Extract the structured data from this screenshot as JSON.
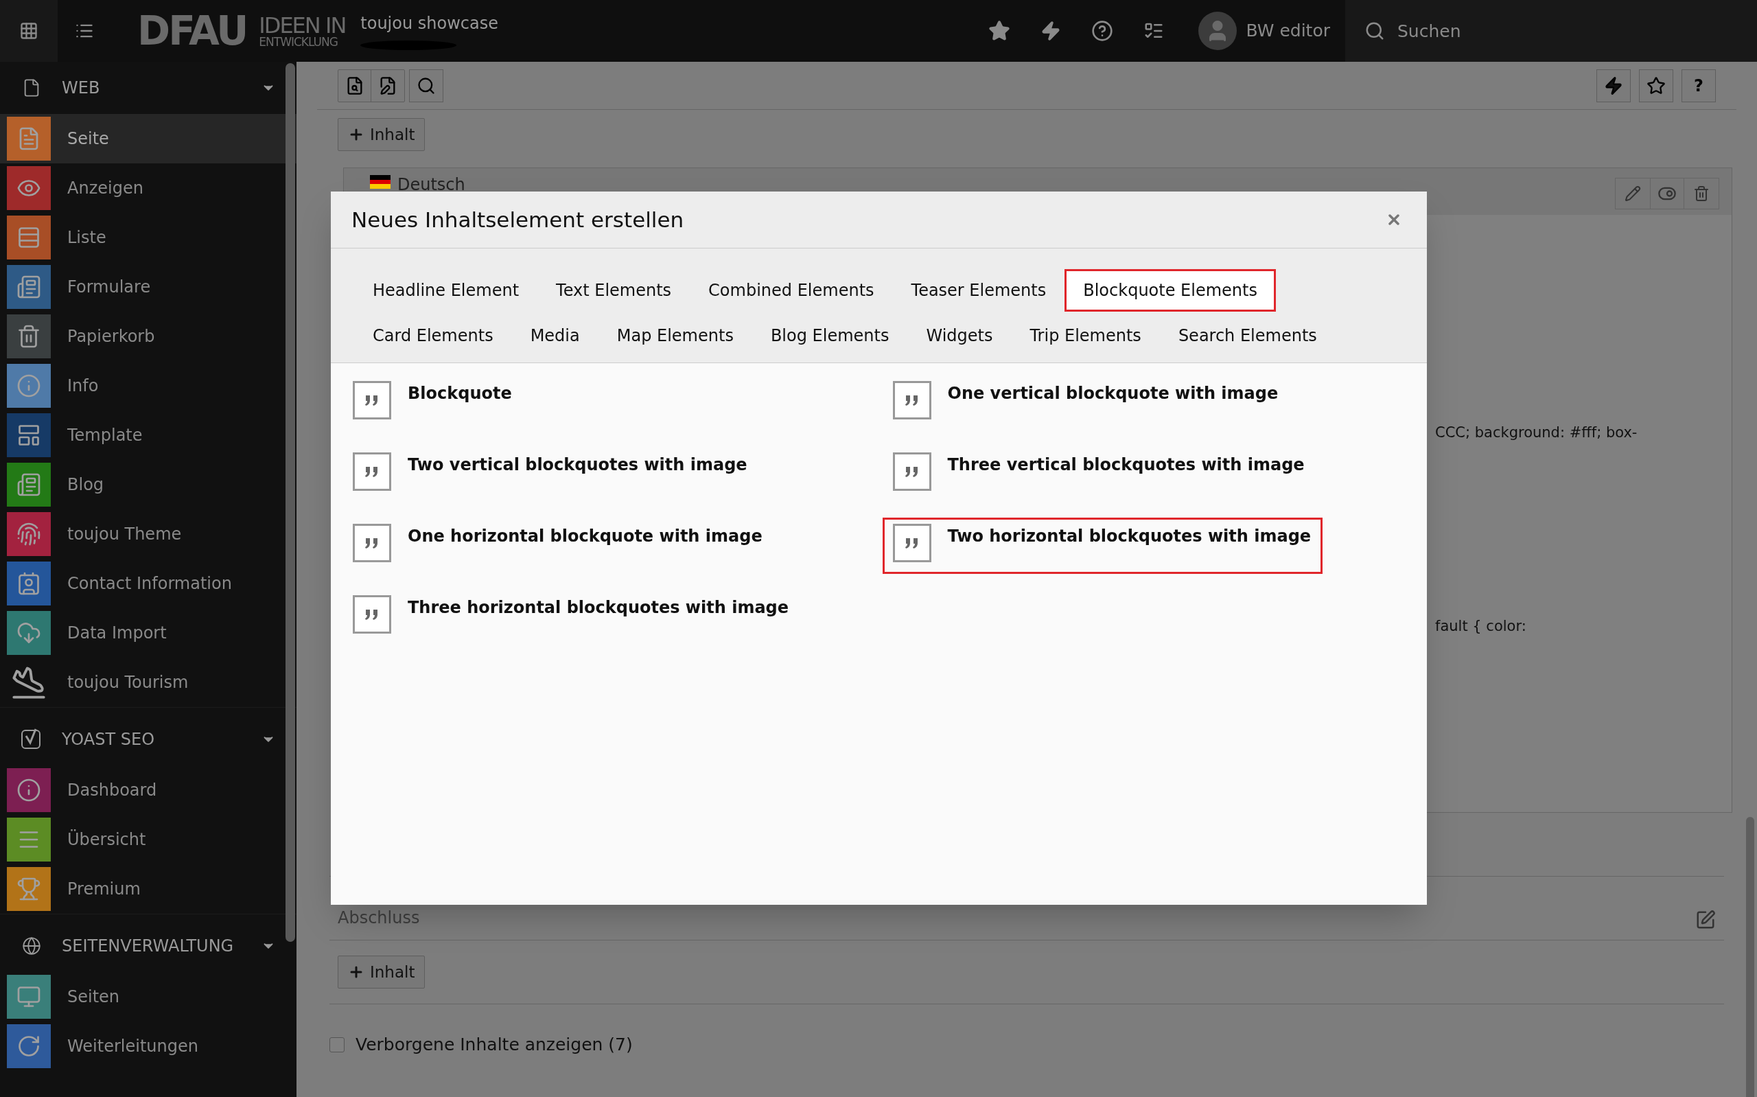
{
  "topbar": {
    "logo_main": "DFAU",
    "logo_sub_top": "IDEEN IN",
    "logo_sub_bottom": "ENTWICKLUNG",
    "site_name": "toujou showcase",
    "user": "BW editor",
    "search_placeholder": "Suchen"
  },
  "sidebar": {
    "groups": [
      {
        "title": "WEB",
        "expanded": true,
        "items": [
          {
            "label": "Seite",
            "color": "#b5602a",
            "selected": true
          },
          {
            "label": "Anzeigen",
            "color": "#9e2a2a",
            "selected": false
          },
          {
            "label": "Liste",
            "color": "#a84e26",
            "selected": false
          },
          {
            "label": "Formulare",
            "color": "#2e5a86",
            "selected": false
          },
          {
            "label": "Papierkorb",
            "color": "#3a3f40",
            "selected": false
          },
          {
            "label": "Info",
            "color": "#4f7aa8",
            "selected": false
          },
          {
            "label": "Template",
            "color": "#163a66",
            "selected": false
          },
          {
            "label": "Blog",
            "color": "#237a16",
            "selected": false
          },
          {
            "label": "toujou Theme",
            "color": "#a3223f",
            "selected": false
          },
          {
            "label": "Contact Information",
            "color": "#24569a",
            "selected": false
          },
          {
            "label": "Data Import",
            "color": "#2e7871",
            "selected": false
          },
          {
            "label": "toujou Tourism",
            "selected": false
          }
        ]
      },
      {
        "title": "YOAST SEO",
        "expanded": true,
        "items": [
          {
            "label": "Dashboard",
            "color": "#7d1f52",
            "selected": false
          },
          {
            "label": "Übersicht",
            "color": "#5c8c24",
            "selected": false
          },
          {
            "label": "Premium",
            "color": "#b27318",
            "selected": false
          }
        ]
      },
      {
        "title": "SEITENVERWALTUNG",
        "expanded": true,
        "items": [
          {
            "label": "Seiten",
            "color": "#3a7f7a",
            "selected": false
          },
          {
            "label": "Weiterleitungen",
            "color": "#2e5a9b",
            "selected": false
          }
        ]
      }
    ]
  },
  "toolbar": {
    "help_label": "?"
  },
  "page": {
    "add_content_top": "Inhalt",
    "language": "Deutsch",
    "code_fragments": [
      "CCC; background: #fff; box-",
      "fault { color:"
    ],
    "section_label": "Abschluss",
    "add_content_bottom": "Inhalt",
    "hidden_toggle": {
      "label": "Verborgene Inhalte anzeigen (7)",
      "checked": false
    }
  },
  "dialog": {
    "title": "Neues Inhaltselement erstellen",
    "tab_rows": [
      [
        {
          "label": "Headline Element",
          "selected": false
        },
        {
          "label": "Text Elements",
          "selected": false
        },
        {
          "label": "Combined Elements",
          "selected": false
        },
        {
          "label": "Teaser Elements",
          "selected": false
        },
        {
          "label": "Blockquote Elements",
          "selected": true
        }
      ],
      [
        {
          "label": "Card Elements",
          "selected": false
        },
        {
          "label": "Media",
          "selected": false
        },
        {
          "label": "Map Elements",
          "selected": false
        },
        {
          "label": "Blog Elements",
          "selected": false
        },
        {
          "label": "Widgets",
          "selected": false
        },
        {
          "label": "Trip Elements",
          "selected": false
        },
        {
          "label": "Search Elements",
          "selected": false
        }
      ]
    ],
    "items": [
      {
        "label": "Blockquote",
        "highlighted": false
      },
      {
        "label": "One vertical blockquote with image",
        "highlighted": false
      },
      {
        "label": "Two vertical blockquotes with image",
        "highlighted": false
      },
      {
        "label": "Three vertical blockquotes with image",
        "highlighted": false
      },
      {
        "label": "One horizontal blockquote with image",
        "highlighted": false
      },
      {
        "label": "Two horizontal blockquotes with image",
        "highlighted": true
      },
      {
        "label": "Three horizontal blockquotes with image",
        "highlighted": false
      }
    ]
  }
}
